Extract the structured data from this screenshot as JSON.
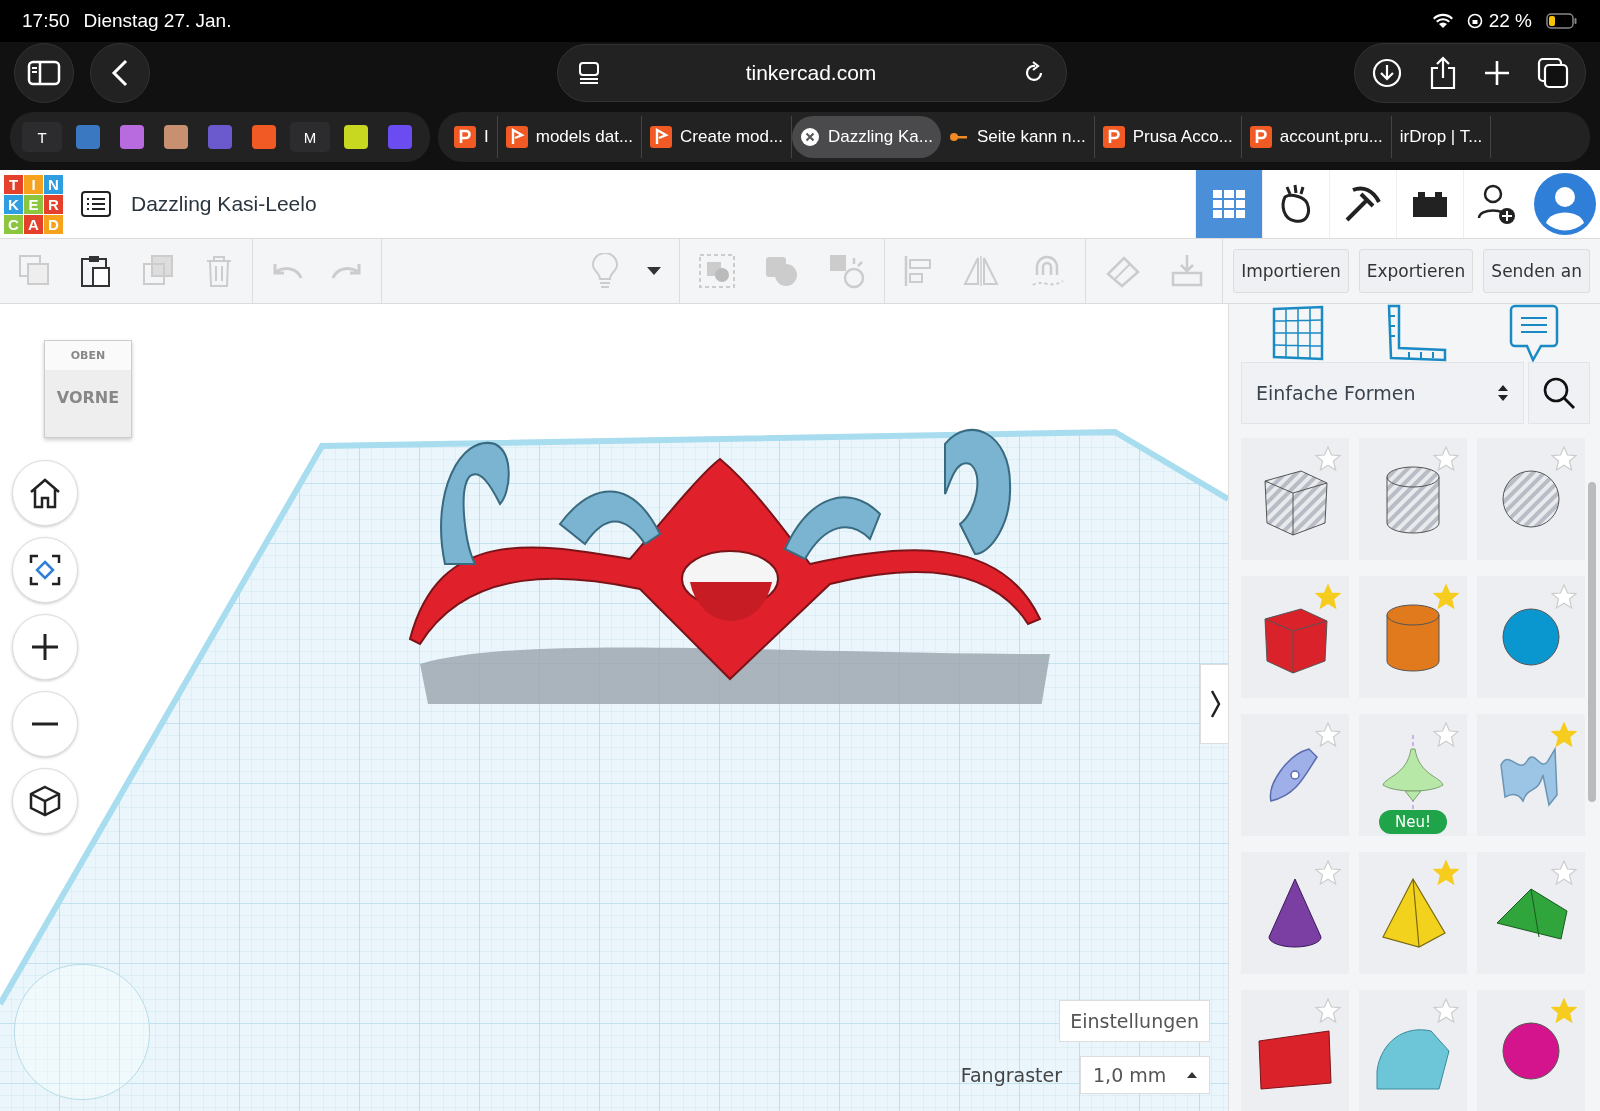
{
  "status_bar": {
    "time": "17:50",
    "date": "Dienstag 27. Jan.",
    "battery": "22 %"
  },
  "browser": {
    "address": "tinkercad.com",
    "pinned_tabs": [
      {
        "label": "T",
        "color": "#2c2c2e"
      },
      {
        "color": "#3a78c2"
      },
      {
        "color": "#b86adf"
      },
      {
        "color": "#c89070"
      },
      {
        "color": "#6a5acd"
      },
      {
        "color": "#f15a24"
      },
      {
        "label": "M",
        "color": "#2c2c2e"
      },
      {
        "color": "#c8d820"
      },
      {
        "color": "#6a4cf0"
      }
    ],
    "tabs": [
      {
        "label": "I",
        "selected": false,
        "kind": "p"
      },
      {
        "label": "models dat...",
        "selected": false,
        "kind": "flag"
      },
      {
        "label": "Create mod...",
        "selected": false,
        "kind": "flag"
      },
      {
        "label": "Dazzling Ka...",
        "selected": true,
        "kind": "close"
      },
      {
        "label": "Seite kann n...",
        "selected": false,
        "kind": "key"
      },
      {
        "label": "Prusa Acco...",
        "selected": false,
        "kind": "p"
      },
      {
        "label": "account.pru...",
        "selected": false,
        "kind": "p"
      },
      {
        "label": "irDrop | T...",
        "selected": false,
        "kind": "plain"
      }
    ]
  },
  "app": {
    "logo_letters": [
      "T",
      "I",
      "N",
      "K",
      "E",
      "R",
      "C",
      "A",
      "D"
    ],
    "project_title": "Dazzling Kasi-Leelo",
    "toolbar_buttons": [
      "Importieren",
      "Exportieren",
      "Senden an"
    ],
    "view_cube": {
      "top": "OBEN",
      "front": "VORNE"
    },
    "settings_button": "Einstellungen",
    "snap_grid": {
      "label": "Fangraster",
      "value": "1,0 mm"
    }
  },
  "shapes_panel": {
    "category": "Einfache Formen",
    "shapes": [
      {
        "kind": "box",
        "hole": true,
        "favorite": false,
        "color": "#b8bcc4"
      },
      {
        "kind": "cylinder",
        "hole": true,
        "favorite": false,
        "color": "#b8bcc4"
      },
      {
        "kind": "sphere",
        "hole": true,
        "favorite": false,
        "color": "#b8bcc4"
      },
      {
        "kind": "box",
        "hole": false,
        "favorite": true,
        "color": "#d9222a"
      },
      {
        "kind": "cylinder",
        "hole": false,
        "favorite": true,
        "color": "#e07a1c"
      },
      {
        "kind": "sphere",
        "hole": false,
        "favorite": false,
        "color": "#0a96cf"
      },
      {
        "kind": "scribble",
        "hole": false,
        "favorite": false,
        "color": "#9fb0e8"
      },
      {
        "kind": "spinner",
        "hole": false,
        "favorite": false,
        "color": "#b8e8a8",
        "badge": "Neu!"
      },
      {
        "kind": "wave",
        "hole": false,
        "favorite": true,
        "color": "#9cc4e4"
      },
      {
        "kind": "cone",
        "hole": false,
        "favorite": false,
        "color": "#7b3fa4"
      },
      {
        "kind": "pyramid",
        "hole": false,
        "favorite": true,
        "color": "#f2d21c"
      },
      {
        "kind": "roof",
        "hole": false,
        "favorite": false,
        "color": "#2fa53c"
      },
      {
        "kind": "text",
        "hole": false,
        "favorite": false,
        "color": "#d9222a"
      },
      {
        "kind": "halfcyl",
        "hole": false,
        "favorite": false,
        "color": "#6cc6d8"
      },
      {
        "kind": "sphere",
        "hole": false,
        "favorite": true,
        "color": "#d4148c"
      }
    ]
  }
}
